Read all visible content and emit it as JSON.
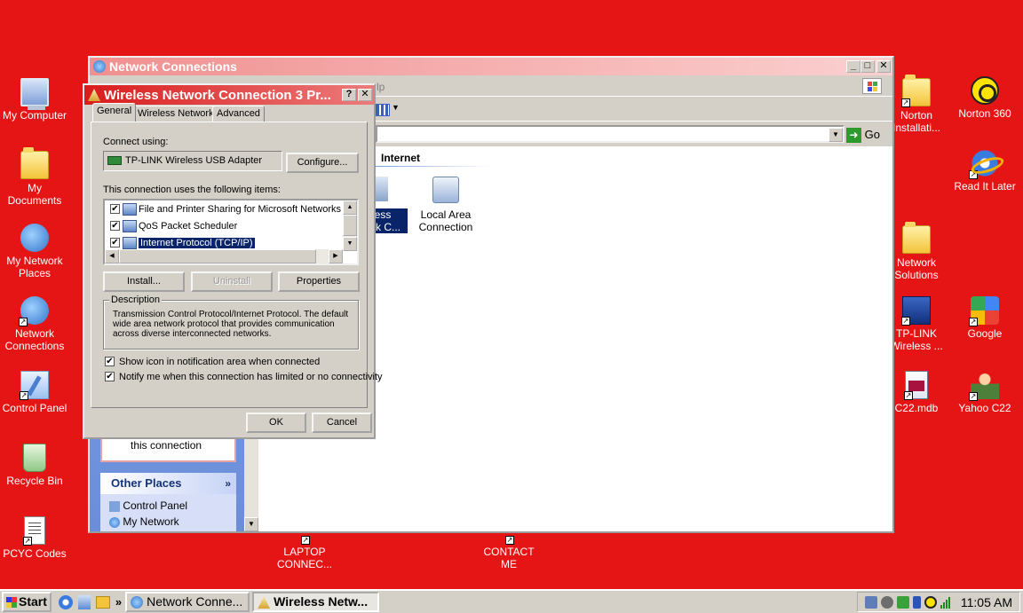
{
  "desktop": {
    "left_icons": [
      {
        "label": "My Computer",
        "icon": "computer-icon"
      },
      {
        "label": "My\nDocuments",
        "icon": "documents-folder-icon"
      },
      {
        "label": "My Network\nPlaces",
        "icon": "network-places-icon"
      },
      {
        "label": "Network\nConnections",
        "icon": "network-connections-icon"
      },
      {
        "label": "Control Panel",
        "icon": "control-panel-icon"
      },
      {
        "label": "Recycle Bin",
        "icon": "recycle-bin-icon"
      },
      {
        "label": "PCYC Codes",
        "icon": "document-icon"
      }
    ],
    "right_col1": [
      {
        "label": "Norton\nInstallati...",
        "icon": "folder-icon"
      },
      {
        "label": "Network\nSolutions",
        "icon": "folder-icon"
      },
      {
        "label": "TP-LINK\nWireless ...",
        "icon": "tplink-icon"
      },
      {
        "label": "C22.mdb",
        "icon": "database-file-icon"
      }
    ],
    "right_col2": [
      {
        "label": "Norton 360",
        "icon": "norton-icon"
      },
      {
        "label": "Read It Later",
        "icon": "internet-explorer-icon"
      },
      {
        "label": "Google",
        "icon": "google-icon"
      },
      {
        "label": "Yahoo C22",
        "icon": "yahoo-icon"
      }
    ],
    "bottom_icons": [
      {
        "label": "LAPTOP\nCONNEC..."
      },
      {
        "label": "CONTACT\nME"
      }
    ]
  },
  "network_window": {
    "title": "Network Connections",
    "menu_fragment": "lp",
    "go_label": "Go",
    "section_header": "Internet",
    "connections": [
      {
        "label": "less\nrk C..."
      },
      {
        "label": "Local Area\nConnection"
      }
    ],
    "task_text": "this connection",
    "other_places_title": "Other Places",
    "other_places": [
      "Control Panel",
      "My Network"
    ]
  },
  "dialog": {
    "title": "Wireless Network Connection 3 Pr...",
    "tabs": [
      "General",
      "Wireless Networks",
      "Advanced"
    ],
    "connect_using_label": "Connect using:",
    "adapter": "TP-LINK Wireless USB Adapter",
    "configure": "Configure...",
    "items_label": "This connection uses the following items:",
    "items": [
      {
        "label": "File and Printer Sharing for Microsoft Networks",
        "checked": "✔"
      },
      {
        "label": "QoS Packet Scheduler",
        "checked": "✔"
      },
      {
        "label": "Internet Protocol (TCP/IP)",
        "checked": "✔"
      }
    ],
    "install": "Install...",
    "uninstall": "Uninstall",
    "properties": "Properties",
    "description_title": "Description",
    "description": "Transmission Control Protocol/Internet Protocol. The default wide area network protocol that provides communication across diverse interconnected networks.",
    "show_icon": "Show icon in notification area when connected",
    "notify": "Notify me when this connection has limited or no connectivity",
    "ok": "OK",
    "cancel": "Cancel"
  },
  "taskbar": {
    "start": "Start",
    "chevron": "»",
    "tasks": [
      "Network Conne...",
      "Wireless Netw..."
    ],
    "clock": "11:05 AM"
  },
  "colors": {
    "desktop": "#e61515",
    "title_active": "#d91c1c",
    "selection": "#0a246a"
  }
}
